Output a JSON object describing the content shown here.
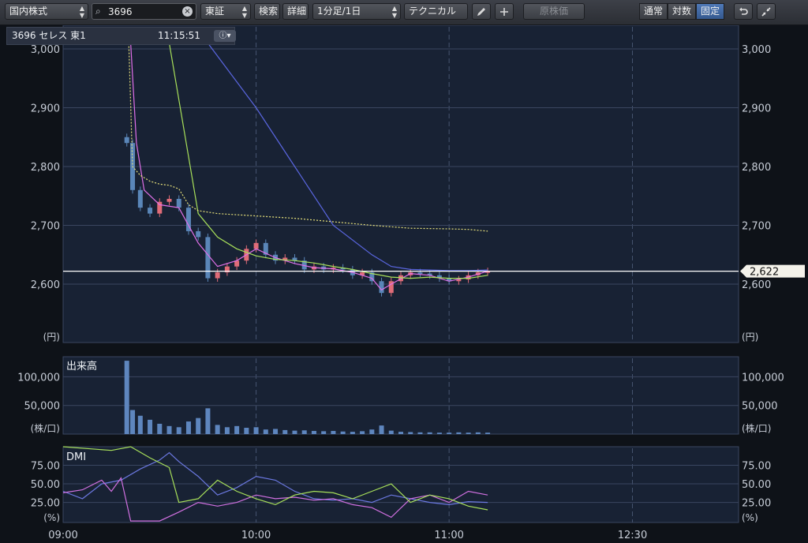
{
  "toolbar": {
    "market": "国内株式",
    "symbol": "3696",
    "exchange": "東証",
    "search_btn": "検索",
    "detail_btn": "詳細",
    "interval": "1分足/1日",
    "technical": "テクニカル",
    "pen_icon": "pencil-icon",
    "plus_icon": "plus-icon",
    "adjusted": "原株価",
    "modes": [
      "通常",
      "対数",
      "固定"
    ],
    "active_mode": "固定",
    "reset_icon": "undo-icon",
    "collapse_icon": "collapse-icon"
  },
  "info": {
    "ticker": "3696 セレス 東1",
    "time": "11:15:51",
    "mode_icon": "info-dropdown-icon"
  },
  "colors": {
    "price_line": "#ffffff",
    "candle_up": "#e06c78",
    "candle_down": "#5a86b8",
    "ma_fast": "#e070e8",
    "ma_mid": "#a8e05a",
    "ma_slow": "#5a66e0",
    "vwap": "#e6e07a",
    "volume": "#5e86be",
    "dmi_plus": "#6b78e0",
    "dmi_minus": "#d070e0",
    "adx": "#a8e05a"
  },
  "chart_data": [
    {
      "type": "candlestick",
      "unit": "(円)",
      "y_ticks": [
        3000,
        2900,
        2800,
        2700,
        2600
      ],
      "ylim": [
        2500,
        3010
      ],
      "current_price": 2622,
      "current_price_label": "2,622",
      "vertical_grid": [
        "10:00",
        "11:00",
        "12:30"
      ],
      "series": [
        {
          "name": "close",
          "x": [
            9.33,
            9.36,
            9.4,
            9.45,
            9.5,
            9.55,
            9.6,
            9.65,
            9.7,
            9.75,
            9.8,
            9.85,
            9.9,
            9.95,
            10.0,
            10.05,
            10.1,
            10.15,
            10.2,
            10.25,
            10.3,
            10.35,
            10.4,
            10.45,
            10.5,
            10.55,
            10.6,
            10.65,
            10.7,
            10.75,
            10.8,
            10.85,
            10.9,
            10.95,
            11.0,
            11.05,
            11.1,
            11.15,
            11.2
          ],
          "y": [
            2840,
            2760,
            2730,
            2720,
            2740,
            2745,
            2730,
            2690,
            2680,
            2610,
            2620,
            2630,
            2640,
            2660,
            2670,
            2650,
            2640,
            2645,
            2640,
            2625,
            2630,
            2625,
            2628,
            2625,
            2615,
            2620,
            2605,
            2585,
            2605,
            2615,
            2620,
            2618,
            2615,
            2610,
            2605,
            2608,
            2615,
            2620,
            2622
          ]
        },
        {
          "name": "ma_fast",
          "x": [
            9.35,
            9.38,
            9.42,
            9.5,
            9.6,
            9.7,
            9.8,
            9.9,
            10.0,
            10.1,
            10.2,
            10.3,
            10.4,
            10.5,
            10.6,
            10.65,
            10.7,
            10.8,
            10.9,
            11.0,
            11.1,
            11.2
          ],
          "y": [
            3010,
            2840,
            2760,
            2735,
            2730,
            2670,
            2630,
            2640,
            2660,
            2645,
            2635,
            2628,
            2626,
            2620,
            2610,
            2590,
            2600,
            2618,
            2615,
            2605,
            2612,
            2622
          ]
        },
        {
          "name": "ma_mid",
          "x": [
            9.55,
            9.7,
            9.8,
            9.9,
            10.0,
            10.1,
            10.2,
            10.3,
            10.4,
            10.5,
            10.6,
            10.7,
            10.8,
            10.9,
            11.0,
            11.1,
            11.2
          ],
          "y": [
            3010,
            2720,
            2680,
            2660,
            2648,
            2642,
            2640,
            2636,
            2630,
            2625,
            2618,
            2612,
            2610,
            2612,
            2610,
            2610,
            2615
          ]
        },
        {
          "name": "ma_slow",
          "x": [
            9.75,
            10.0,
            10.2,
            10.4,
            10.6,
            10.7,
            10.8,
            10.9,
            11.0,
            11.1,
            11.2
          ],
          "y": [
            3010,
            2900,
            2800,
            2700,
            2650,
            2630,
            2625,
            2624,
            2623,
            2623,
            2624
          ]
        },
        {
          "name": "vwap",
          "x": [
            9.34,
            9.36,
            9.4,
            9.45,
            9.5,
            9.55,
            9.6,
            9.65,
            9.7,
            9.8,
            9.9,
            10.0,
            10.2,
            10.4,
            10.6,
            10.8,
            11.0,
            11.1,
            11.2
          ],
          "y": [
            3010,
            2800,
            2785,
            2775,
            2770,
            2768,
            2762,
            2735,
            2725,
            2720,
            2718,
            2716,
            2712,
            2706,
            2700,
            2695,
            2694,
            2693,
            2690
          ]
        }
      ]
    },
    {
      "type": "bar",
      "title": "出来高",
      "unit": "(株/口)",
      "y_ticks": [
        100000,
        50000
      ],
      "ylim": [
        0,
        135000
      ],
      "x": [
        9.33,
        9.36,
        9.4,
        9.45,
        9.5,
        9.55,
        9.6,
        9.65,
        9.7,
        9.75,
        9.8,
        9.85,
        9.9,
        9.95,
        10.0,
        10.05,
        10.1,
        10.15,
        10.2,
        10.25,
        10.3,
        10.35,
        10.4,
        10.45,
        10.5,
        10.55,
        10.6,
        10.65,
        10.7,
        10.75,
        10.8,
        10.85,
        10.9,
        10.95,
        11.0,
        11.05,
        11.1,
        11.15,
        11.2
      ],
      "values": [
        128000,
        42000,
        32000,
        25000,
        18000,
        14000,
        12000,
        22000,
        28000,
        45000,
        16000,
        12000,
        14000,
        11000,
        12000,
        8000,
        9000,
        7000,
        6000,
        6500,
        5500,
        5000,
        5500,
        4500,
        4000,
        5000,
        8000,
        15000,
        6000,
        4000,
        3500,
        3000,
        3000,
        2500,
        2500,
        3000,
        2500,
        3000,
        2500
      ]
    },
    {
      "type": "line",
      "title": "DMI",
      "unit": "(%)",
      "y_ticks": [
        75,
        50,
        25
      ],
      "y_tick_labels": [
        "75.00",
        "50.00",
        "25.00"
      ],
      "ylim": [
        -2,
        100
      ],
      "x_ticks": [
        "09:00",
        "10:00",
        "11:00",
        "12:30"
      ],
      "series": [
        {
          "name": "plus",
          "x": [
            9.0,
            9.1,
            9.2,
            9.3,
            9.4,
            9.5,
            9.55,
            9.6,
            9.7,
            9.8,
            9.9,
            10.0,
            10.1,
            10.2,
            10.3,
            10.4,
            10.5,
            10.6,
            10.7,
            10.8,
            10.9,
            11.0,
            11.1,
            11.2
          ],
          "y": [
            40,
            30,
            50,
            55,
            70,
            82,
            92,
            80,
            60,
            35,
            45,
            60,
            55,
            40,
            30,
            28,
            30,
            25,
            35,
            30,
            25,
            22,
            26,
            25
          ]
        },
        {
          "name": "minus",
          "x": [
            9.0,
            9.1,
            9.2,
            9.25,
            9.3,
            9.35,
            9.4,
            9.5,
            9.6,
            9.7,
            9.8,
            9.9,
            10.0,
            10.1,
            10.2,
            10.3,
            10.4,
            10.5,
            10.6,
            10.7,
            10.8,
            10.9,
            11.0,
            11.1,
            11.2
          ],
          "y": [
            38,
            42,
            55,
            40,
            58,
            0,
            0,
            0,
            12,
            25,
            20,
            25,
            35,
            30,
            32,
            28,
            30,
            22,
            18,
            5,
            30,
            35,
            25,
            40,
            35
          ]
        },
        {
          "name": "adx",
          "x": [
            9.0,
            9.25,
            9.35,
            9.45,
            9.55,
            9.6,
            9.7,
            9.8,
            9.9,
            10.0,
            10.1,
            10.2,
            10.3,
            10.4,
            10.5,
            10.6,
            10.7,
            10.8,
            10.9,
            11.0,
            11.1,
            11.2
          ],
          "y": [
            100,
            95,
            100,
            85,
            72,
            25,
            30,
            55,
            40,
            30,
            22,
            35,
            40,
            38,
            30,
            40,
            50,
            25,
            35,
            30,
            20,
            15
          ]
        }
      ]
    }
  ]
}
